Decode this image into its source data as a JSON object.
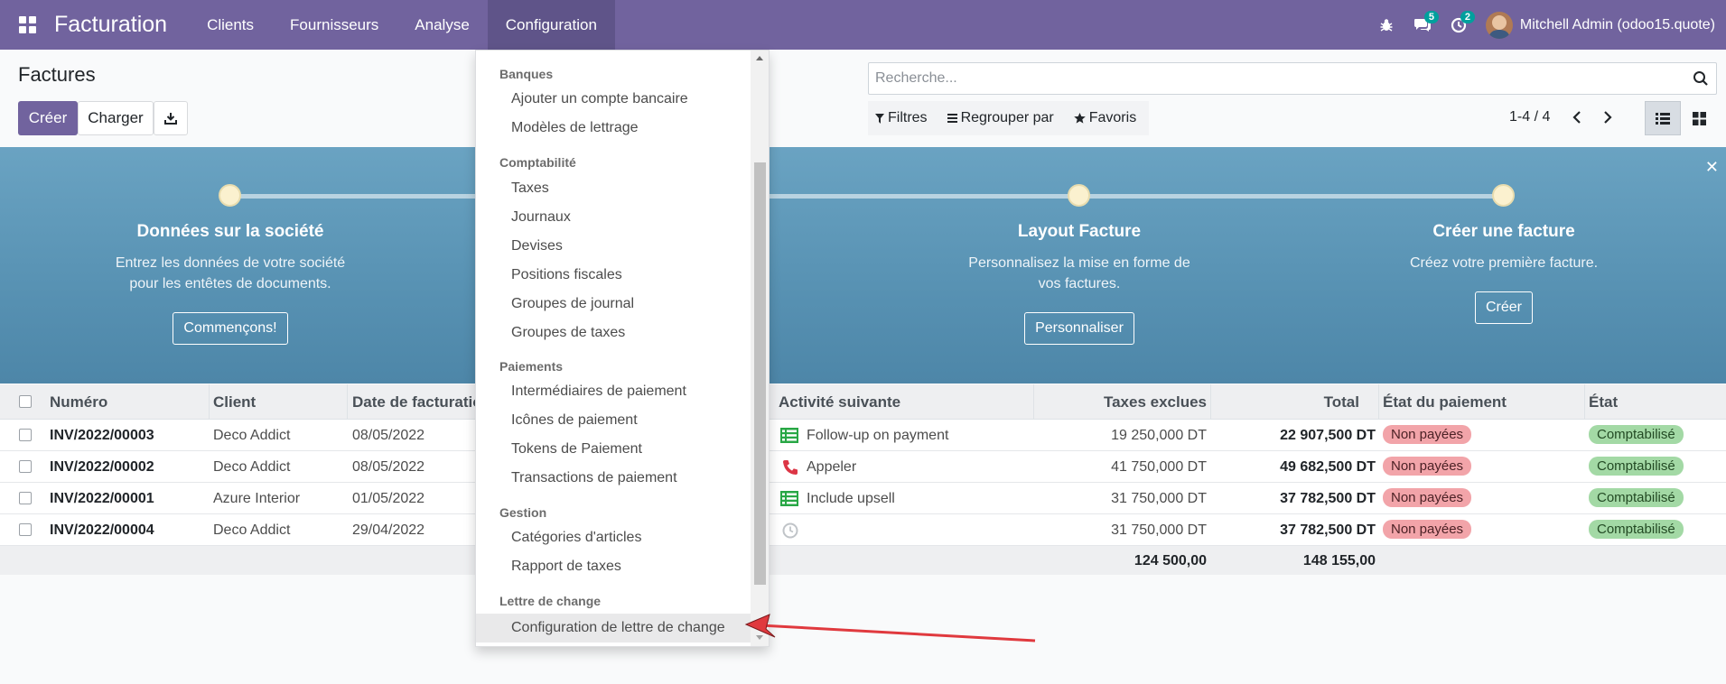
{
  "navbar": {
    "app_name": "Facturation",
    "menu": [
      "Clients",
      "Fournisseurs",
      "Analyse",
      "Configuration"
    ],
    "active_menu": "Configuration",
    "messages_count": "5",
    "activities_count": "2",
    "user": "Mitchell Admin (odoo15.quote)"
  },
  "control_panel": {
    "title": "Factures",
    "create_label": "Créer",
    "upload_label": "Charger",
    "search_placeholder": "Recherche...",
    "filters_label": "Filtres",
    "groupby_label": "Regrouper par",
    "favorites_label": "Favoris",
    "pager": "1-4 / 4"
  },
  "banner": {
    "steps": [
      {
        "title": "Données sur la société",
        "desc1": "Entrez les données de votre société",
        "desc2": "pour les entêtes de documents.",
        "button": "Commençons!"
      },
      {
        "title": "Layout Facture",
        "desc1": "Personnalisez la mise en forme de",
        "desc2": "vos factures.",
        "button": "Personnaliser"
      },
      {
        "title": "Créer une facture",
        "desc1": "Créez votre première facture.",
        "desc2": "",
        "button": "Créer"
      }
    ]
  },
  "table": {
    "headers": {
      "number": "Numéro",
      "client": "Client",
      "date": "Date de facturatio",
      "activity": "Activité suivante",
      "tax_excl": "Taxes exclues",
      "total": "Total",
      "payment_state": "État du paiement",
      "state": "État"
    },
    "rows": [
      {
        "number": "INV/2022/00003",
        "client": "Deco Addict",
        "date": "08/05/2022",
        "activity_icon": "list-icon",
        "activity": "Follow-up on payment",
        "tax_excl": "19 250,000 DT",
        "total": "22 907,500 DT",
        "payment": "Non payées",
        "state": "Comptabilisé"
      },
      {
        "number": "INV/2022/00002",
        "client": "Deco Addict",
        "date": "08/05/2022",
        "activity_icon": "phone-icon",
        "activity": "Appeler",
        "tax_excl": "41 750,000 DT",
        "total": "49 682,500 DT",
        "payment": "Non payées",
        "state": "Comptabilisé"
      },
      {
        "number": "INV/2022/00001",
        "client": "Azure Interior",
        "date": "01/05/2022",
        "activity_icon": "list-icon",
        "activity": "Include upsell",
        "tax_excl": "31 750,000 DT",
        "total": "37 782,500 DT",
        "payment": "Non payées",
        "state": "Comptabilisé"
      },
      {
        "number": "INV/2022/00004",
        "client": "Deco Addict",
        "date": "29/04/2022",
        "activity_icon": "clock-icon",
        "activity": "",
        "tax_excl": "31 750,000 DT",
        "total": "37 782,500 DT",
        "payment": "Non payées",
        "state": "Comptabilisé"
      }
    ],
    "totals": {
      "tax_excl": "124 500,00",
      "total": "148 155,00"
    }
  },
  "dropdown": {
    "sections": [
      {
        "header": "Banques",
        "items": [
          "Ajouter un compte bancaire",
          "Modèles de lettrage"
        ]
      },
      {
        "header": "Comptabilité",
        "items": [
          "Taxes",
          "Journaux",
          "Devises",
          "Positions fiscales",
          "Groupes de journal",
          "Groupes de taxes"
        ]
      },
      {
        "header": "Paiements",
        "items": [
          "Intermédiaires de paiement",
          "Icônes de paiement",
          "Tokens de Paiement",
          "Transactions de paiement"
        ]
      },
      {
        "header": "Gestion",
        "items": [
          "Catégories d'articles",
          "Rapport de taxes"
        ]
      },
      {
        "header": "Lettre de change",
        "items": [
          "Configuration de lettre de change"
        ]
      }
    ],
    "highlighted_item": "Configuration de lettre de change"
  },
  "colors": {
    "brand": "#71639e",
    "badge": "#00a09d",
    "unpaid": "#f2a4a9",
    "posted": "#a3d9a5",
    "annotation_arrow": "#e0393e"
  }
}
